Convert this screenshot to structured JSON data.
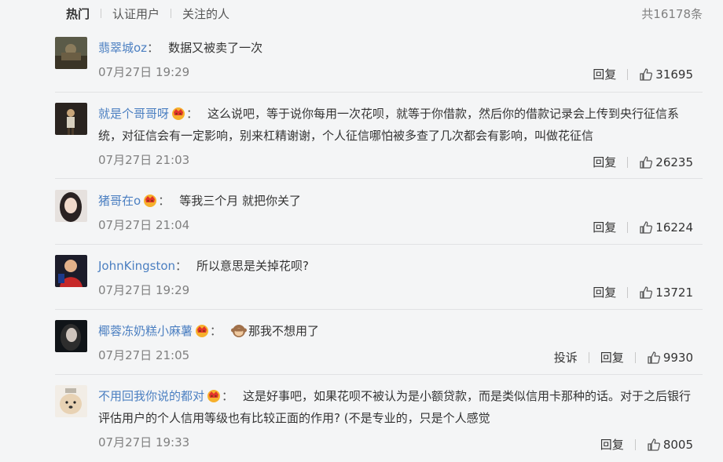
{
  "tabs": [
    "热门",
    "认证用户",
    "关注的人"
  ],
  "total": "共16178条",
  "labels": {
    "reply": "回复",
    "report": "投诉"
  },
  "colon": "：",
  "comments": [
    {
      "user": "翡翠城oz",
      "text": "数据又被卖了一次",
      "time": "07月27日 19:29",
      "likes": "31695",
      "crown": false
    },
    {
      "user": "就是个哥哥呀",
      "text": "这么说吧，等于说你每用一次花呗，就等于你借款，然后你的借款记录会上传到央行征信系统，对征信会有一定影响，别来杠精谢谢，个人征信哪怕被多查了几次都会有影响，叫做花征信",
      "time": "07月27日 21:03",
      "likes": "26235",
      "crown": true
    },
    {
      "user": "猪哥在o",
      "text": "等我三个月 就把你关了",
      "time": "07月27日 21:04",
      "likes": "16224",
      "crown": true
    },
    {
      "user": "JohnKingston",
      "text": "所以意思是关掉花呗?",
      "time": "07月27日 19:29",
      "likes": "13721",
      "crown": false
    },
    {
      "user": "椰蓉冻奶糕小麻薯",
      "text": "那我不想用了",
      "time": "07月27日 21:05",
      "likes": "9930",
      "crown": true
    },
    {
      "user": "不用回我你说的都对",
      "text": "这是好事吧，如果花呗不被认为是小额贷款，而是类似信用卡那种的话。对于之后银行评估用户的个人信用等级也有比较正面的作用? (不是专业的，只是个人感觉",
      "time": "07月27日 19:33",
      "likes": "8005",
      "crown": true
    }
  ],
  "colors": {
    "link": "#4b7fc1",
    "meta": "#808080",
    "background": "#f4f5f6"
  }
}
